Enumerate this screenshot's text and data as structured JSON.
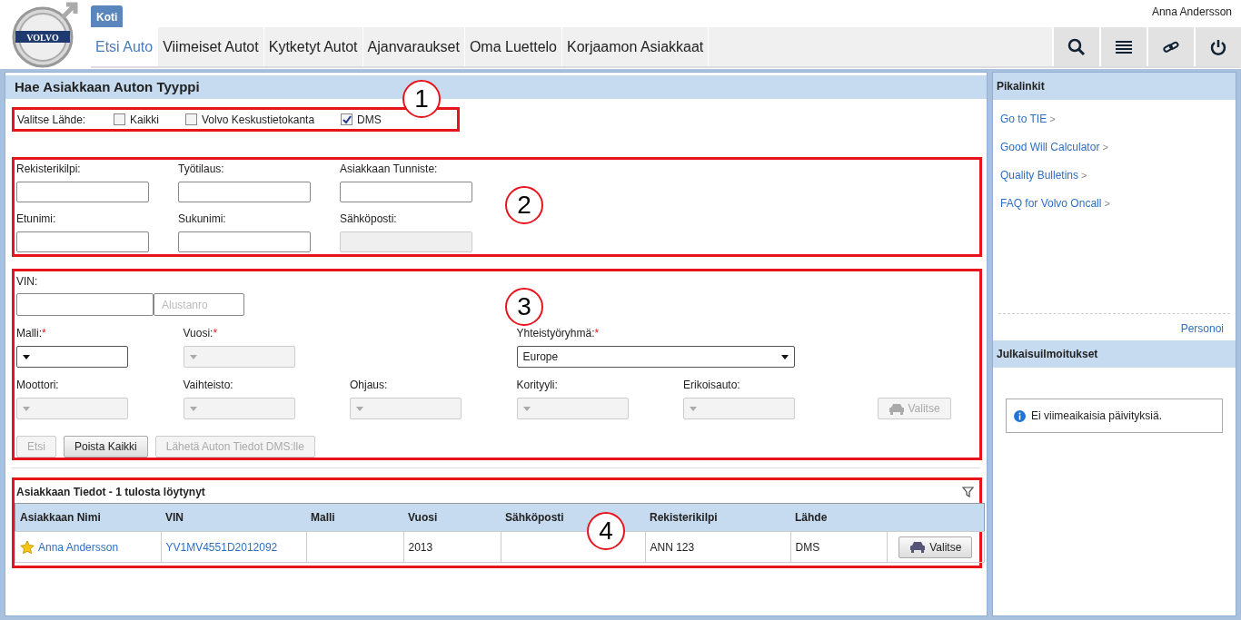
{
  "header": {
    "logo_text": "VOLVO",
    "tab": "Koti",
    "user": "Anna Andersson",
    "nav": [
      {
        "label": "Etsi Auto",
        "selected": true
      },
      {
        "label": "Viimeiset Autot",
        "selected": false
      },
      {
        "label": "Kytketyt Autot",
        "selected": false
      },
      {
        "label": "Ajanvaraukset",
        "selected": false
      },
      {
        "label": "Oma Luettelo",
        "selected": false
      },
      {
        "label": "Korjaamon Asiakkaat",
        "selected": false
      }
    ],
    "tools": [
      {
        "kind": "search"
      },
      {
        "kind": "list"
      },
      {
        "kind": "link"
      },
      {
        "kind": "power"
      }
    ]
  },
  "search_panel": {
    "title": "Hae Asiakkaan Auton Tyyppi",
    "source": {
      "label": "Valitse Lähde:",
      "options": [
        {
          "label": "Kaikki",
          "checked": false
        },
        {
          "label": "Volvo Keskustietokanta",
          "checked": false
        },
        {
          "label": "DMS",
          "checked": true
        }
      ]
    },
    "person_fields": [
      {
        "label": "Rekisterikilpi:",
        "disabled": false
      },
      {
        "label": "Työtilaus:",
        "disabled": false
      },
      {
        "label": "Asiakkaan Tunniste:",
        "disabled": false
      },
      {
        "label": "Etunimi:",
        "disabled": false
      },
      {
        "label": "Sukunimi:",
        "disabled": false
      },
      {
        "label": "Sähköposti:",
        "disabled": true
      }
    ],
    "vin": {
      "label": "VIN:",
      "placeholder": "Alustanro"
    },
    "required_mark": "*",
    "select_rows": [
      [
        {
          "label": "Malli:",
          "required": true,
          "disabled": false
        },
        {
          "label": "Vuosi:",
          "required": true,
          "disabled": true
        },
        {
          "label": "Yhteistyöryhmä:",
          "required": true,
          "disabled": false,
          "value": "Europe"
        }
      ],
      [
        {
          "label": "Moottori:",
          "required": false,
          "disabled": true
        },
        {
          "label": "Vaihteisto:",
          "required": false,
          "disabled": true
        },
        {
          "label": "Ohjaus:",
          "required": false,
          "disabled": true
        },
        {
          "label": "Korityyli:",
          "required": false,
          "disabled": true
        },
        {
          "label": "Erikoisauto:",
          "required": false,
          "disabled": true
        }
      ]
    ],
    "choose_button": {
      "label": "Valitse",
      "disabled": true
    },
    "buttons": [
      {
        "label": "Etsi",
        "disabled": true
      },
      {
        "label": "Poista Kaikki",
        "disabled": false
      },
      {
        "label": "Lähetä Auton Tiedot DMS:lle",
        "disabled": true
      }
    ],
    "results": {
      "title": "Asiakkaan Tiedot",
      "count": "- 1 tulosta löytynyt",
      "columns": [
        "Asiakkaan Nimi",
        "VIN",
        "Malli",
        "Vuosi",
        "Sähköposti",
        "Rekisterikilpi",
        "Lähde"
      ],
      "rows": [
        {
          "starred": true,
          "cells": [
            "Anna Andersson",
            "YV1MV4551D2012092",
            null,
            "2013",
            null,
            "ANN 123",
            "DMS"
          ],
          "button": "Valitse"
        }
      ]
    },
    "callouts": [
      "1",
      "2",
      "3",
      "4"
    ]
  },
  "sidebar": {
    "quick_links": {
      "title": "Pikalinkit",
      "links": [
        "Go to TIE",
        "Good Will Calculator",
        "Quality Bulletins",
        "FAQ for Volvo Oncall"
      ],
      "chevron": ">",
      "personalize": "Personoi"
    },
    "news": {
      "title": "Julkaisuilmoitukset",
      "message": "Ei viimeaikaisia päivityksiä."
    }
  }
}
